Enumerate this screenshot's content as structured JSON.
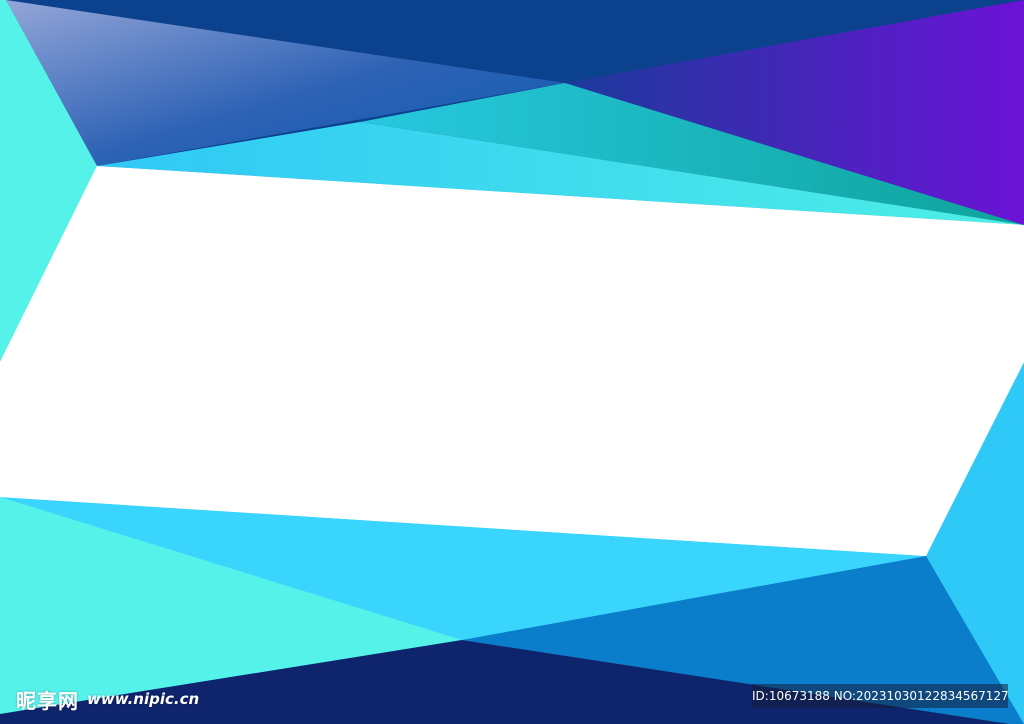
{
  "watermark": {
    "site_name": "昵享网",
    "site_url": "www.nipic.cn",
    "id_text": "ID:10673188 NO:20231030122834567127"
  },
  "colors": {
    "cyan_light": "#55F2EA",
    "sky_blue": "#2EC9F7",
    "bright_blue": "#39D5FD",
    "mid_blue": "#0A6FB9",
    "deep_blue": "#0C418E",
    "navy": "#0E246C",
    "teal": "#10A9A9",
    "purple": "#6B13D6",
    "white": "#FFFFFF"
  }
}
